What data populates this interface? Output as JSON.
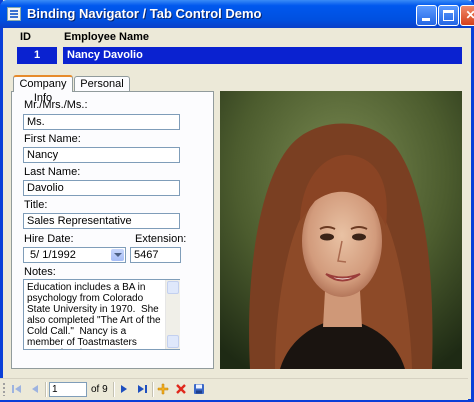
{
  "window": {
    "title": "Binding Navigator / Tab Control Demo"
  },
  "header": {
    "id_label": "ID",
    "name_label": "Employee Name",
    "id_value": "1",
    "name_value": "Nancy Davolio"
  },
  "tabs": [
    {
      "label": "Company Info",
      "selected": true
    },
    {
      "label": "Personal Info",
      "selected": false
    }
  ],
  "form": {
    "courtesy_label": "Mr./Mrs./Ms.:",
    "courtesy_value": "Ms.",
    "first_label": "First Name:",
    "first_value": "Nancy",
    "last_label": "Last Name:",
    "last_value": "Davolio",
    "title_label": "Title:",
    "title_value": "Sales Representative",
    "hire_label": "Hire Date:",
    "hire_value": "5/  1/1992",
    "ext_label": "Extension:",
    "ext_value": "5467",
    "notes_label": "Notes:",
    "notes_value": "Education includes a BA in psychology from Colorado State University in 1970.  She also completed \"The Art of the Cold Call.\"  Nancy is a member of Toastmasters International."
  },
  "navigator": {
    "position": "1",
    "count": "of 9",
    "icons": [
      "move-first-icon",
      "move-previous-icon",
      "move-next-icon",
      "move-last-icon",
      "add-new-icon",
      "delete-icon",
      "save-icon"
    ]
  },
  "colors": {
    "titlebar": "#0058ee",
    "selection": "#0a22d0",
    "window_bg": "#ece9d8",
    "tab_accent": "#e68b2c"
  }
}
